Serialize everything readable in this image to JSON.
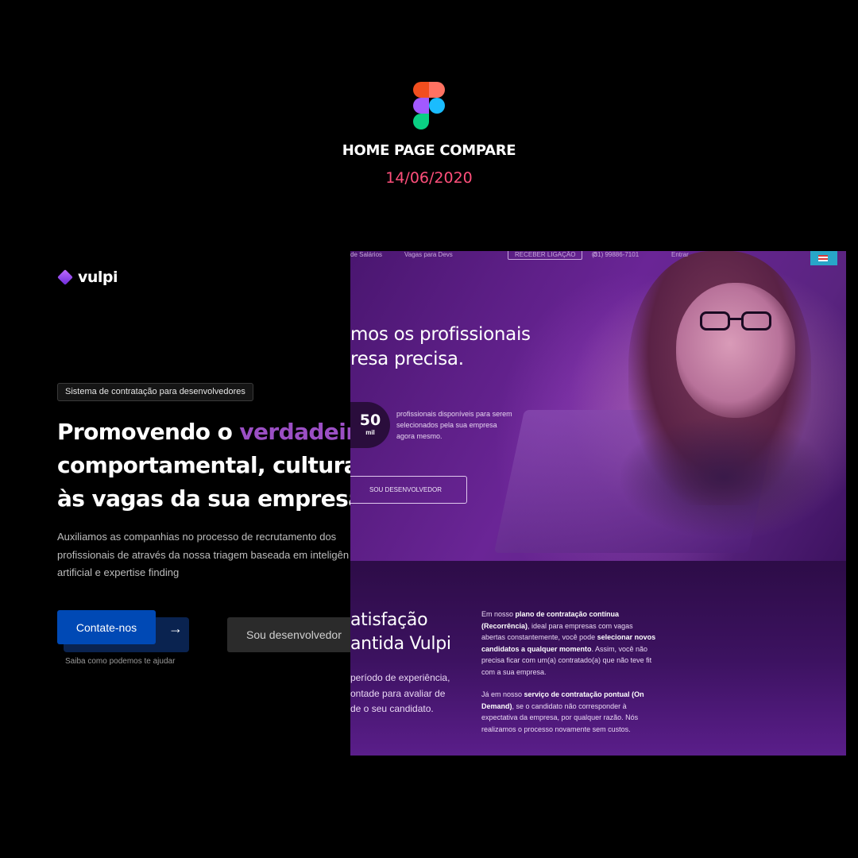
{
  "header": {
    "title": "HOME PAGE COMPARE",
    "date": "14/06/2020"
  },
  "new_design": {
    "brand": "vulpi",
    "tag": "Sistema de contratação para desenvolvedores",
    "headline": {
      "line1_prefix": "Promovendo o ",
      "line1_accent": "verdadeiro m",
      "line2": "comportamental, cultural e",
      "line3": "às vagas da sua empresa"
    },
    "subtext": {
      "line1": "Auxiliamos as companhias no processo de recrutamento dos",
      "line2": "profissionais de através da nossa triagem baseada em inteligên",
      "line3": "artificial e expertise finding"
    },
    "primary_button": "Contate-nos",
    "primary_arrow": "→",
    "primary_help": "Saiba como podemos te ajudar",
    "secondary_button": "Sou desenvolvedor"
  },
  "old_design": {
    "nav": [
      "de Salários",
      "Vagas para Devs",
      "RECEBER LIGAÇÃO",
      "(31) 99886-7101",
      "Entrar"
    ],
    "headline": {
      "line1": "mos os profissionais",
      "line2": "resa precisa."
    },
    "stat": {
      "number": "50",
      "unit": "mil",
      "text": "profissionais disponíveis para serem selecionados pela sua empresa agora mesmo."
    },
    "hero_button": "SOU DESENVOLVEDOR",
    "section": {
      "title_line1": "atisfação",
      "title_line2": "antida Vulpi",
      "sub_line1": "período de experiência,",
      "sub_line2": "ontade para avaliar de",
      "sub_line3": "de o seu candidato.",
      "para1_prefix": "Em nosso ",
      "para1_bold1": "plano de contratação contínua (Recorrência)",
      "para1_mid": ", ideal para empresas com vagas abertas constantemente, você pode ",
      "para1_bold2": "selecionar novos candidatos a qualquer momento",
      "para1_suffix": ". Assim, você não precisa ficar com um(a) contratado(a) que não teve fit com a sua empresa.",
      "para2_prefix": "Já em nosso ",
      "para2_bold": "serviço de contratação pontual (On Demand)",
      "para2_suffix": ", se o candidato não corresponder à expectativa da empresa, por qualquer razão. Nós realizamos o processo novamente sem custos."
    }
  },
  "colors": {
    "accent_pink": "#ff4f7b",
    "accent_purple": "#9b4fc4",
    "primary_blue": "#0049b5"
  },
  "icons": [
    "figma-logo-icon",
    "vulpi-logo-icon",
    "arrow-right-icon",
    "whatsapp-icon",
    "us-flag-icon"
  ]
}
